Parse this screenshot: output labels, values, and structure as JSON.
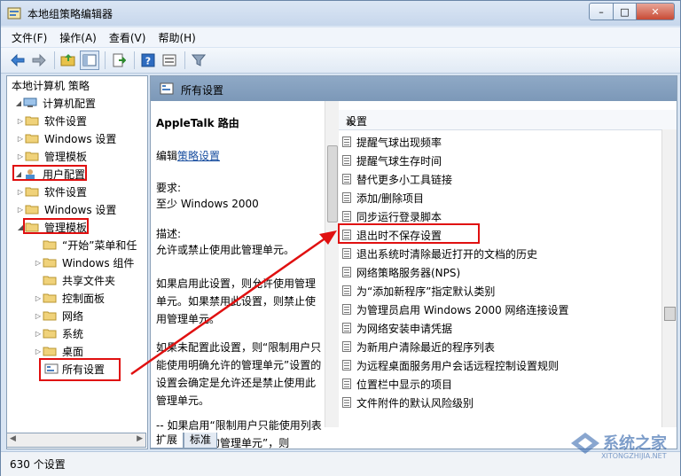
{
  "window": {
    "title": "本地组策略编辑器",
    "min": "–",
    "max": "□",
    "close": "✕"
  },
  "menu": [
    "文件(F)",
    "操作(A)",
    "查看(V)",
    "帮助(H)"
  ],
  "tree": {
    "root": "本地计算机 策略",
    "items": [
      "计算机配置",
      "软件设置",
      "Windows 设置",
      "管理模板",
      "用户配置",
      "软件设置",
      "Windows 设置",
      "管理模板",
      "“开始”菜单和任",
      "Windows 组件",
      "共享文件夹",
      "控制面板",
      "网络",
      "系统",
      "桌面",
      "所有设置"
    ]
  },
  "header": {
    "title": "所有设置"
  },
  "description": {
    "heading": "AppleTalk 路由",
    "edit_prefix": "编辑",
    "edit_link": "策略设置",
    "req_label": "要求:",
    "req_value": "至少 Windows 2000",
    "desc_label": "描述:",
    "desc_text": "允许或禁止使用此管理单元。",
    "para1": "如果启用此设置，则允许使用管理单元。如果禁用此设置，则禁止使用管理单元。",
    "para2": "如果未配置此设置，则“限制用户只能使用明确允许的管理单元”设置的设置会确定是允许还是禁止使用此管理单元。",
    "para3": "-- 如果启用“限制用户只能使用列表中明确允许的管理单元”，则"
  },
  "list": {
    "column": "设置",
    "items": [
      "提醒气球出现频率",
      "提醒气球生存时间",
      "替代更多小工具链接",
      "添加/删除项目",
      "同步运行登录脚本",
      "退出时不保存设置",
      "退出系统时清除最近打开的文档的历史",
      "网络策略服务器(NPS)",
      "为“添加新程序”指定默认类别",
      "为管理员启用 Windows 2000 网络连接设置",
      "为网络安装申请凭据",
      "为新用户清除最近的程序列表",
      "为远程桌面服务用户会话远程控制设置规则",
      "位置栏中显示的项目",
      "文件附件的默认风险级别"
    ]
  },
  "tabs": [
    "扩展",
    "标准"
  ],
  "status": "630 个设置",
  "colors": {
    "highlight": "#e01010",
    "header": "#8fa9c6"
  },
  "watermark": {
    "text": "系统之家",
    "sub": "XITONGZHIJIA.NET"
  }
}
